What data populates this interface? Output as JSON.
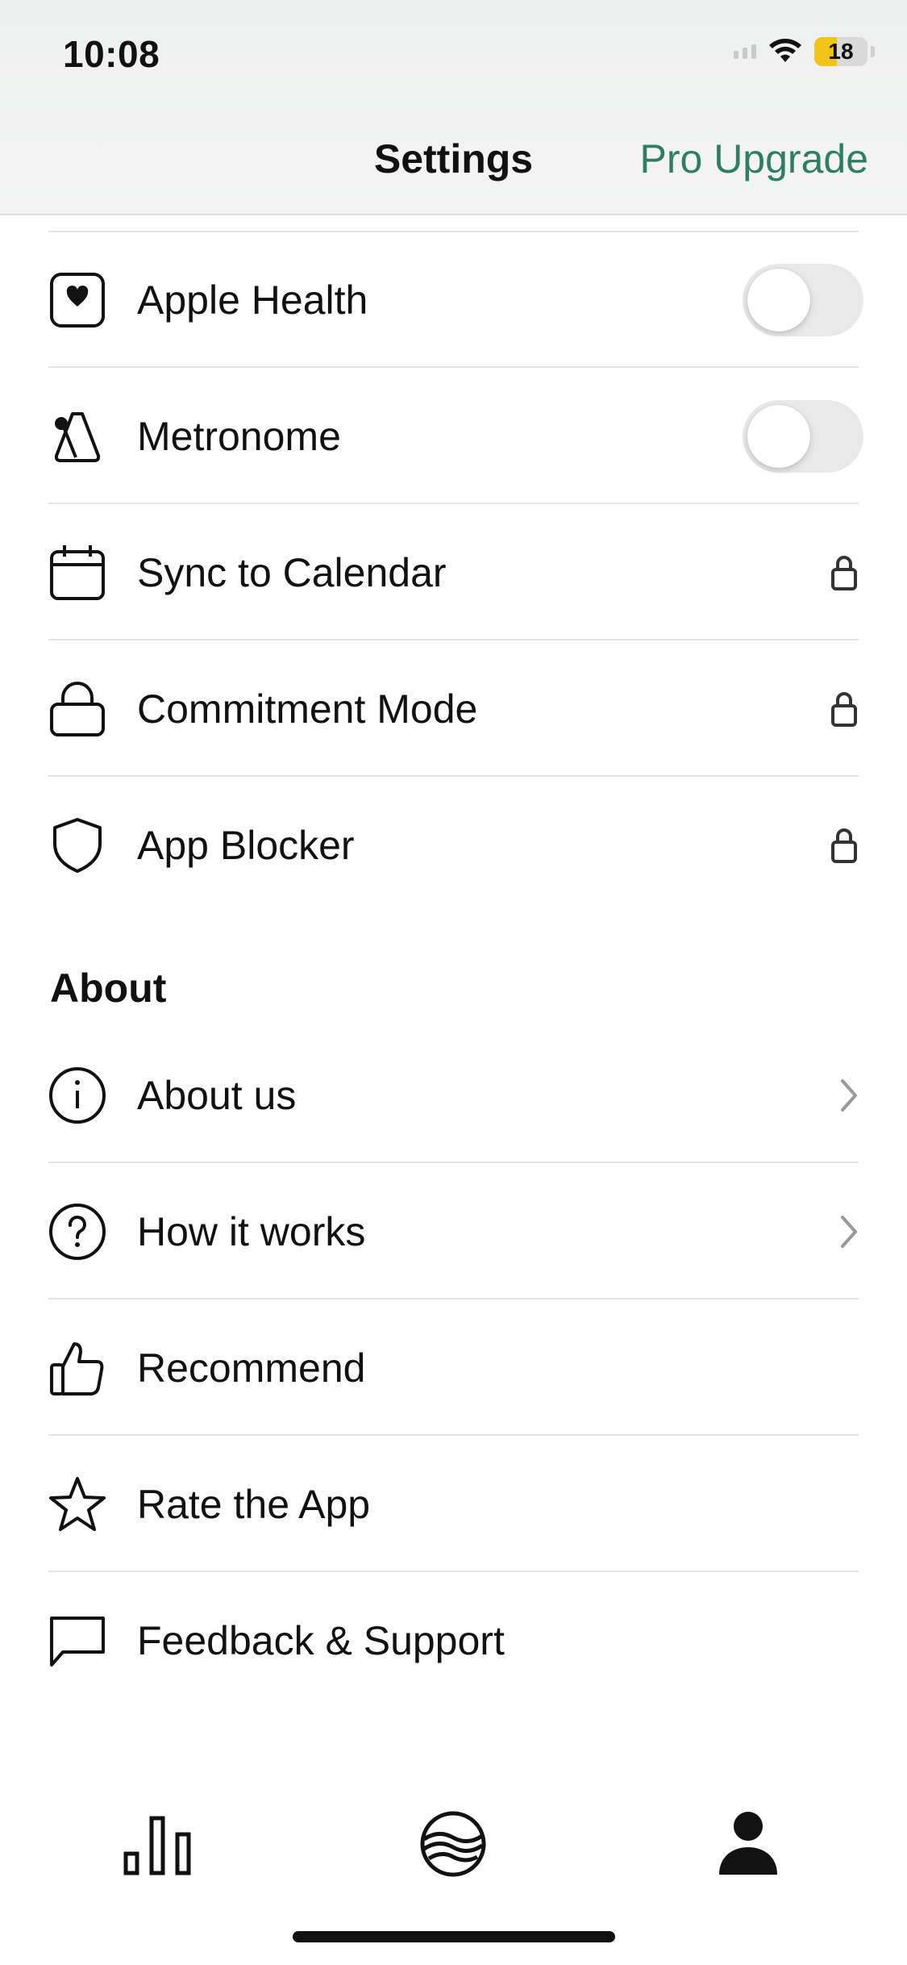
{
  "status_bar": {
    "time": "10:08",
    "battery_level": "18",
    "battery_fraction": 0.18
  },
  "nav": {
    "title": "Settings",
    "pro_link": "Pro Upgrade"
  },
  "colors": {
    "accent": "#2e7d64",
    "battery": "#f2c318",
    "divider": "#e3e3e3"
  },
  "integrations": [
    {
      "label": "Apple Health",
      "icon": "heart-square-icon",
      "control": "toggle",
      "on": false
    },
    {
      "label": "Metronome",
      "icon": "metronome-icon",
      "control": "toggle",
      "on": false
    },
    {
      "label": "Sync to Calendar",
      "icon": "calendar-icon",
      "control": "lock"
    },
    {
      "label": "Commitment Mode",
      "icon": "padlock-icon",
      "control": "lock"
    },
    {
      "label": "App Blocker",
      "icon": "shield-icon",
      "control": "lock"
    }
  ],
  "about": {
    "title": "About",
    "items": [
      {
        "label": "About us",
        "icon": "info-icon",
        "trailing": "chevron"
      },
      {
        "label": "How it works",
        "icon": "question-icon",
        "trailing": "chevron"
      },
      {
        "label": "Recommend",
        "icon": "thumbs-up-icon"
      },
      {
        "label": "Rate the App",
        "icon": "star-icon"
      },
      {
        "label": "Feedback & Support",
        "icon": "chat-bubble-icon"
      }
    ]
  },
  "tabbar": {
    "items": [
      {
        "name": "statistics",
        "icon": "bar-chart-icon",
        "active": false
      },
      {
        "name": "sessions",
        "icon": "wave-globe-icon",
        "active": false
      },
      {
        "name": "profile",
        "icon": "person-icon",
        "active": true
      }
    ]
  }
}
